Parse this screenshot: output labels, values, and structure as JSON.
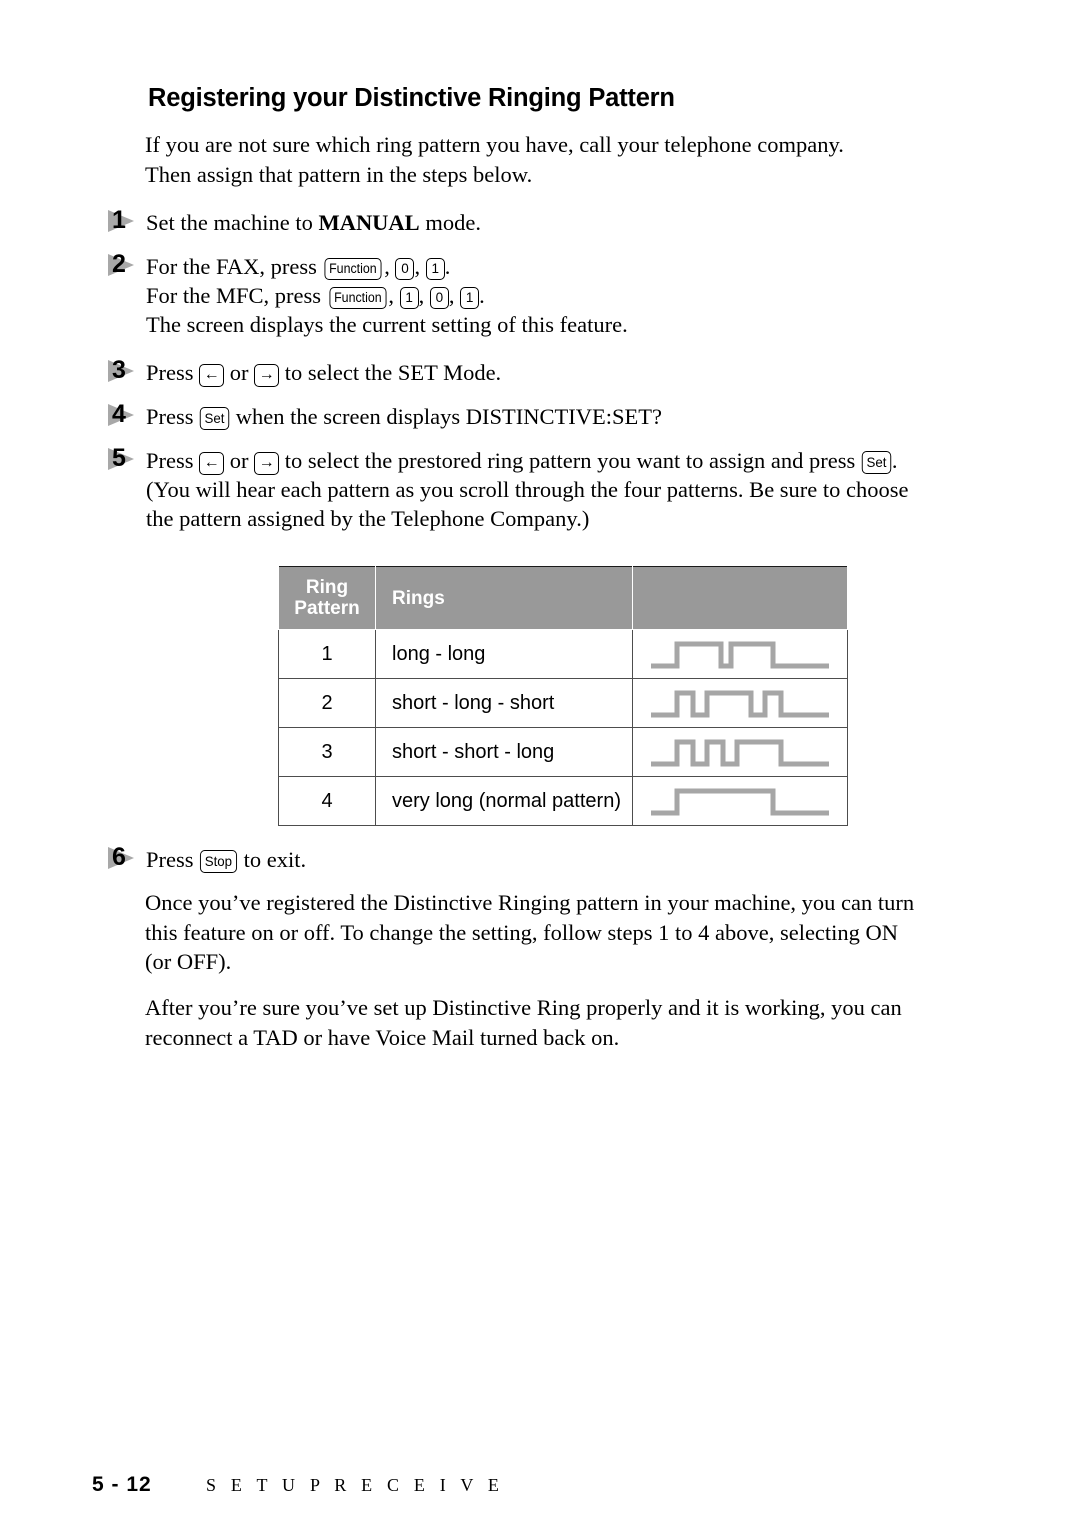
{
  "heading": "Registering your Distinctive Ringing Pattern",
  "intro": "If you are not sure which ring pattern you have, call your telephone company. Then assign that pattern in the steps below.",
  "steps": [
    {
      "number": "1",
      "parts": [
        {
          "t": "text",
          "v": "Set the machine to "
        },
        {
          "t": "bold",
          "v": "MANUAL"
        },
        {
          "t": "text",
          "v": " mode."
        }
      ]
    },
    {
      "number": "2",
      "line1_pre": "For the FAX, press ",
      "line1_keys": [
        "Function",
        "0",
        "1"
      ],
      "line2_pre": "For the MFC, press ",
      "line2_keys": [
        "Function",
        "1",
        "0",
        "1"
      ],
      "line3": "The screen displays the current setting of this feature."
    },
    {
      "number": "3",
      "pre": "Press ",
      "key_left": "←",
      "mid": " or ",
      "key_right": "→",
      "post": " to select the SET Mode."
    },
    {
      "number": "4",
      "pre": "Press ",
      "key_set": "Set",
      "post": " when the screen displays DISTINCTIVE:SET?"
    },
    {
      "number": "5",
      "pre": "Press ",
      "key_left": "←",
      "mid": " or ",
      "key_right": "→",
      "post_a": " to select the prestored ring pattern you want to assign and press ",
      "key_set": "Set",
      "post_b": ". (You will hear each pattern as you scroll through the four patterns. Be sure to choose the pattern assigned by the Telephone Company.)"
    },
    {
      "number": "6",
      "pre": "Press ",
      "key_stop": "Stop",
      "post": " to exit."
    }
  ],
  "table": {
    "headers": [
      "Ring Pattern",
      "Rings",
      ""
    ],
    "header_pattern_line1": "Ring",
    "header_pattern_line2": "Pattern",
    "header_rings": "Rings",
    "header_wave": "",
    "header_bg": "#999999",
    "header_text_color": "#ffffff",
    "wave_color": "#a6a6a6",
    "rows": [
      {
        "pattern": "1",
        "rings": "long - long",
        "wave": "long-long"
      },
      {
        "pattern": "2",
        "rings": "short - long - short",
        "wave": "short-long-short"
      },
      {
        "pattern": "3",
        "rings": "short - short - long",
        "wave": "short-short-long"
      },
      {
        "pattern": "4",
        "rings": "very long (normal pattern)",
        "wave": "very-long"
      }
    ]
  },
  "closing_paragraph_1": "Once you’ve registered the Distinctive Ringing pattern in your machine, you can turn this feature on or off.  To change the setting, follow steps 1 to 4 above, selecting ON (or OFF).",
  "closing_paragraph_2": "After you’re sure you’ve set up Distinctive Ring properly and it is working, you can reconnect a TAD or have Voice Mail turned back on.",
  "footer": {
    "page": "5 - 12",
    "section": "S E T U P   R E C E I V E"
  }
}
